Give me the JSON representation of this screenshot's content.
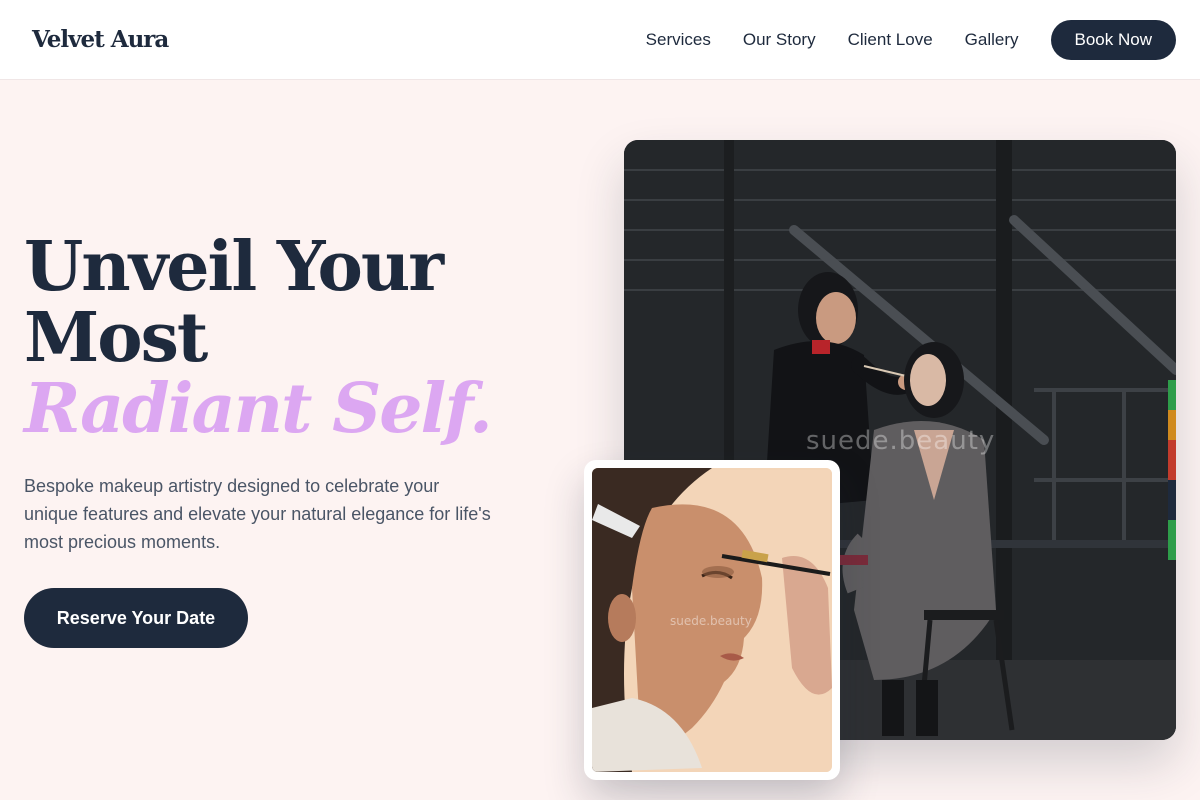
{
  "brand": {
    "logo_text": "Velvet Aura"
  },
  "nav": {
    "items": [
      {
        "label": "Services"
      },
      {
        "label": "Our Story"
      },
      {
        "label": "Client Love"
      },
      {
        "label": "Gallery"
      }
    ],
    "cta_label": "Book Now"
  },
  "hero": {
    "title_line1": "Unveil Your",
    "title_line2": "Most",
    "title_accent": "Radiant Self.",
    "description": "Bespoke makeup artistry designed to celebrate your unique features and elevate your natural elegance for life's most precious moments.",
    "cta_label": "Reserve Your Date"
  },
  "images": {
    "main_watermark": "suede.beauty",
    "inset_watermark": "suede.beauty"
  },
  "colors": {
    "page_background": "#fdf3f2",
    "navy": "#1e2a3d",
    "accent_lilac": "#dca7f2",
    "body_text": "#4a5566"
  }
}
